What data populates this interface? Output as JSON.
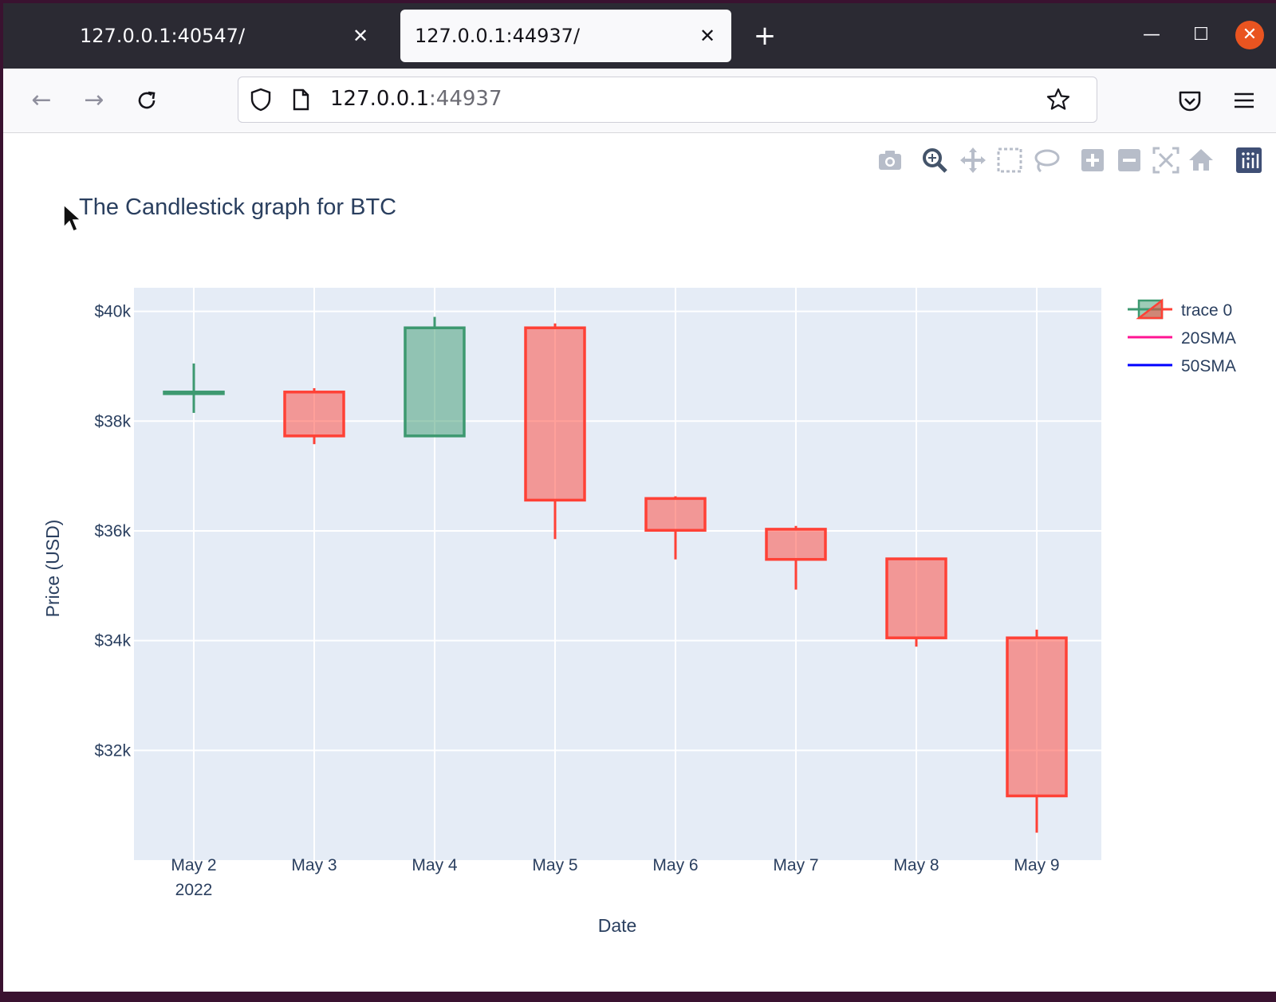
{
  "browser": {
    "tabs": [
      {
        "title": "127.0.0.1:40547/",
        "active": false
      },
      {
        "title": "127.0.0.1:44937/",
        "active": true
      }
    ],
    "new_tab": "+",
    "url_host": "127.0.0.1",
    "url_port": ":44937"
  },
  "chart_data": {
    "type": "candlestick",
    "title": "The Candlestick graph for BTC",
    "xlabel": "Date",
    "ylabel": "Price (USD)",
    "x_ticks": [
      "May 2",
      "May 3",
      "May 4",
      "May 5",
      "May 6",
      "May 7",
      "May 8",
      "May 9"
    ],
    "x_year_label": "2022",
    "y_ticks": [
      "$32k",
      "$34k",
      "$36k",
      "$38k",
      "$40k"
    ],
    "y_tick_values": [
      32000,
      34000,
      36000,
      38000,
      40000
    ],
    "ylim": [
      30000,
      40430
    ],
    "grid": true,
    "legend_position": "right",
    "legend": [
      "trace 0",
      "20SMA",
      "50SMA"
    ],
    "series_colors": {
      "increasing": "#3d9970",
      "decreasing": "#ff4136",
      "20SMA": "#ff1493",
      "50SMA": "#0000ff"
    },
    "candles": [
      {
        "date": "May 2",
        "open": 38500,
        "high": 39050,
        "low": 38150,
        "close": 38530
      },
      {
        "date": "May 3",
        "open": 38530,
        "high": 38600,
        "low": 37580,
        "close": 37730
      },
      {
        "date": "May 4",
        "open": 37730,
        "high": 39900,
        "low": 37730,
        "close": 39700
      },
      {
        "date": "May 5",
        "open": 39700,
        "high": 39780,
        "low": 35850,
        "close": 36560
      },
      {
        "date": "May 6",
        "open": 36590,
        "high": 36630,
        "low": 35480,
        "close": 36010
      },
      {
        "date": "May 7",
        "open": 36030,
        "high": 36090,
        "low": 34930,
        "close": 35480
      },
      {
        "date": "May 8",
        "open": 35490,
        "high": 35490,
        "low": 33890,
        "close": 34050
      },
      {
        "date": "May 9",
        "open": 34050,
        "high": 34200,
        "low": 30500,
        "close": 31170
      }
    ]
  }
}
